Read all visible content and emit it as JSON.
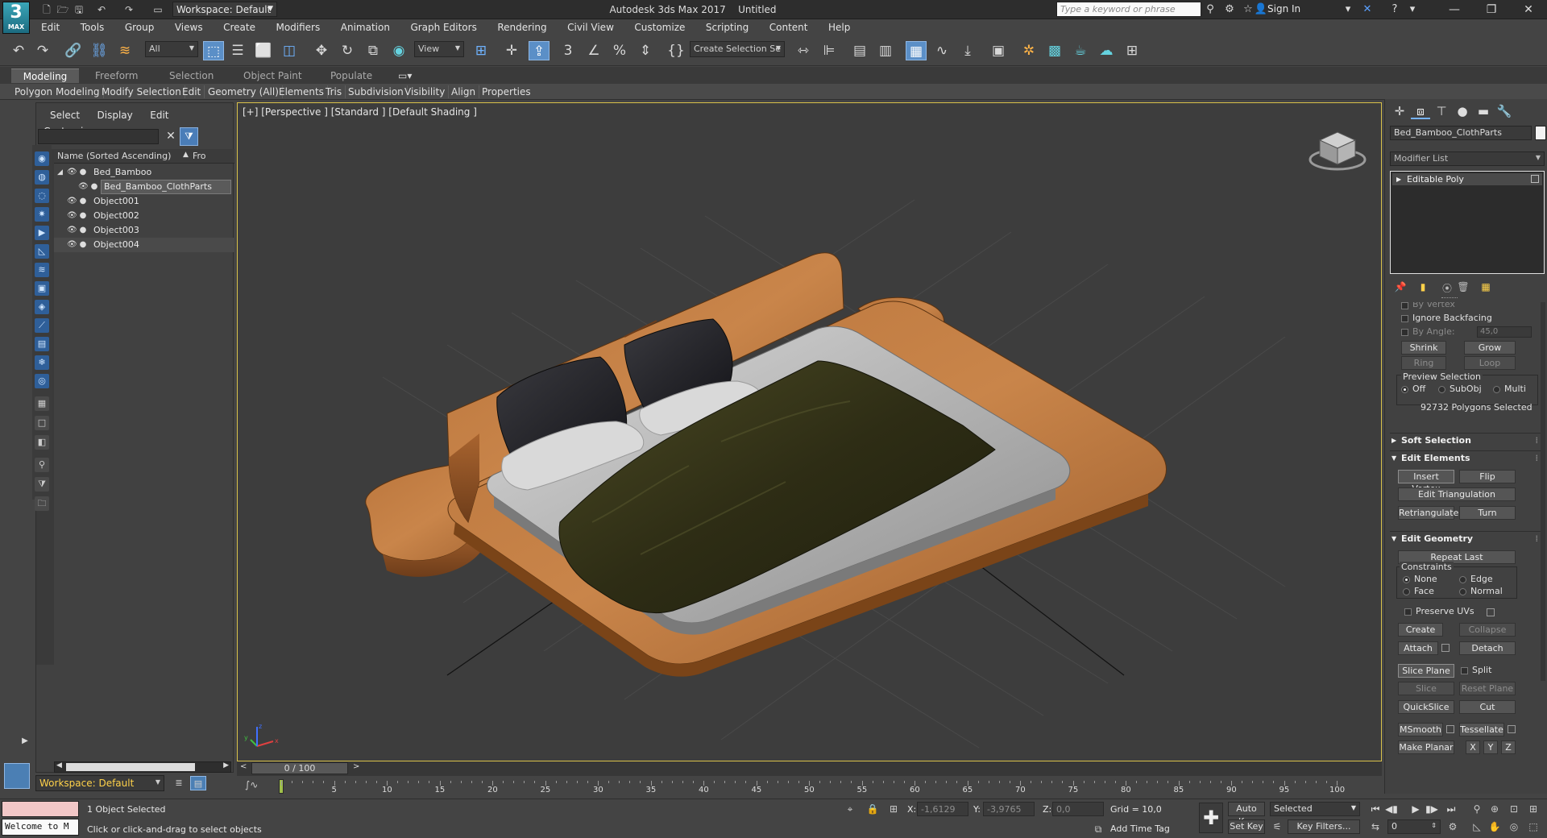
{
  "app": {
    "logo_number": "3",
    "logo_text": "MAX",
    "title": "Autodesk 3ds Max 2017",
    "document": "Untitled",
    "workspace": "Workspace: Default",
    "search_placeholder": "Type a keyword or phrase",
    "sign_in": "Sign In"
  },
  "menu": [
    "Edit",
    "Tools",
    "Group",
    "Views",
    "Create",
    "Modifiers",
    "Animation",
    "Graph Editors",
    "Rendering",
    "Civil View",
    "Customize",
    "Scripting",
    "Content",
    "Help"
  ],
  "toolbar": {
    "selection_filter": "All",
    "ref_coord": "View",
    "named_selection": "Create Selection Se"
  },
  "ribbon": {
    "tabs": [
      "Modeling",
      "Freeform",
      "Selection",
      "Object Paint",
      "Populate"
    ],
    "active_tab": "Modeling",
    "subtabs": [
      "Polygon Modeling",
      "Modify Selection",
      "Edit",
      "Geometry (All)",
      "Elements",
      "Tris",
      "Subdivision",
      "Visibility",
      "Align",
      "Properties"
    ]
  },
  "scene_explorer": {
    "tabs": [
      "Select",
      "Display",
      "Edit",
      "Customize"
    ],
    "col_name": "Name (Sorted Ascending)",
    "col_from": "Fro",
    "rows": [
      {
        "name": "Bed_Bamboo",
        "level": 0,
        "expanded": true,
        "selected": false
      },
      {
        "name": "Bed_Bamboo_ClothParts",
        "level": 1,
        "selected": true
      },
      {
        "name": "Object001",
        "level": 0,
        "selected": false
      },
      {
        "name": "Object002",
        "level": 0,
        "selected": false
      },
      {
        "name": "Object003",
        "level": 0,
        "selected": false
      },
      {
        "name": "Object004",
        "level": 0,
        "selected": false
      }
    ],
    "workspace": "Workspace: Default"
  },
  "viewport": {
    "label": "[+] [Perspective ] [Standard ] [Default Shading ]",
    "border_color": "#d9c14a"
  },
  "command_panel": {
    "object_name": "Bed_Bamboo_ClothParts",
    "modifier_list": "Modifier List",
    "stack_item": "Editable Poly",
    "selection": {
      "by_vertex": "By Vertex",
      "ignore_backfacing": "Ignore Backfacing",
      "by_angle": "By Angle:",
      "angle_value": "45,0",
      "shrink": "Shrink",
      "grow": "Grow",
      "ring": "Ring",
      "loop": "Loop",
      "preview_selection": "Preview Selection",
      "preview_off": "Off",
      "preview_subobj": "SubObj",
      "preview_multi": "Multi",
      "selected_count": "92732 Polygons Selected"
    },
    "soft_selection": "Soft Selection",
    "edit_elements": {
      "title": "Edit Elements",
      "insert_vertex": "Insert Vertex",
      "flip": "Flip",
      "edit_triangulation": "Edit Triangulation",
      "retriangulate": "Retriangulate",
      "turn": "Turn"
    },
    "edit_geometry": {
      "title": "Edit Geometry",
      "repeat_last": "Repeat Last",
      "constraints": "Constraints",
      "c_none": "None",
      "c_edge": "Edge",
      "c_face": "Face",
      "c_normal": "Normal",
      "preserve_uvs": "Preserve UVs",
      "create": "Create",
      "collapse": "Collapse",
      "attach": "Attach",
      "detach": "Detach",
      "slice_plane": "Slice Plane",
      "split": "Split",
      "slice": "Slice",
      "reset_plane": "Reset Plane",
      "quickslice": "QuickSlice",
      "cut": "Cut",
      "msmooth": "MSmooth",
      "tessellate": "Tessellate",
      "make_planar": "Make Planar",
      "x": "X",
      "y": "Y",
      "z": "Z"
    }
  },
  "timeline": {
    "frame": "0 / 100",
    "ticks": [
      5,
      10,
      15,
      20,
      25,
      30,
      35,
      40,
      45,
      50,
      55,
      60,
      65,
      70,
      75,
      80,
      85,
      90,
      95,
      100
    ]
  },
  "status": {
    "maxscript": "Welcome to M",
    "selected": "1 Object Selected",
    "prompt": "Click or click-and-drag to select objects",
    "x_label": "X:",
    "x": "-1,6129",
    "y_label": "Y:",
    "y": "-3,9765",
    "z_label": "Z:",
    "z": "0,0",
    "grid": "Grid = 10,0",
    "add_time_tag": "Add Time Tag",
    "auto_key": "Auto Key",
    "set_key": "Set Key",
    "key_mode": "Selected",
    "key_filters": "Key Filters...",
    "current_frame": "0"
  }
}
